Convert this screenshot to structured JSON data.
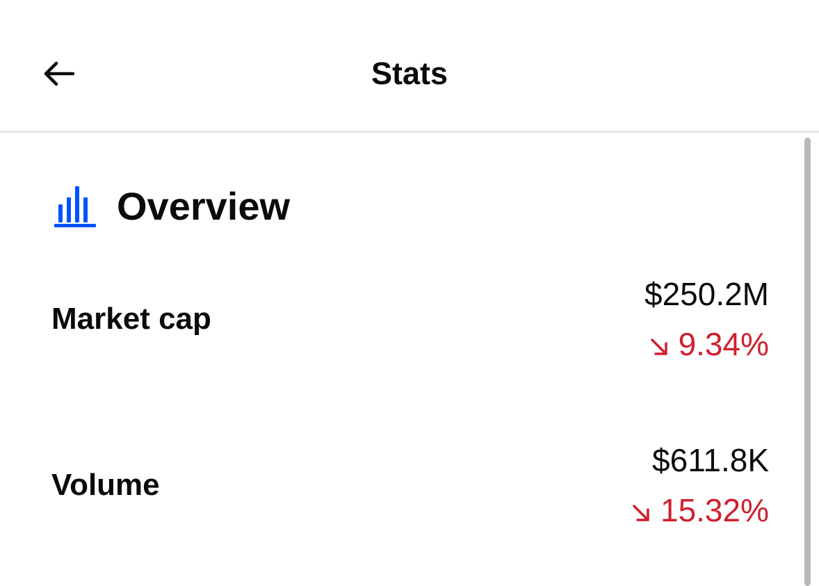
{
  "header": {
    "title": "Stats",
    "back_icon": "arrow-left-icon"
  },
  "overview": {
    "icon": "bar-chart-icon",
    "icon_color": "#0052ff",
    "title": "Overview"
  },
  "stats": [
    {
      "label": "Market cap",
      "value": "$250.2M",
      "change": "9.34%",
      "direction": "down",
      "change_icon": "arrow-down-right-icon"
    },
    {
      "label": "Volume",
      "value": "$611.8K",
      "change": "15.32%",
      "direction": "down",
      "change_icon": "arrow-down-right-icon"
    }
  ],
  "colors": {
    "negative": "#cf202f",
    "text": "#0a0b0d",
    "divider": "#e2e4e7"
  }
}
